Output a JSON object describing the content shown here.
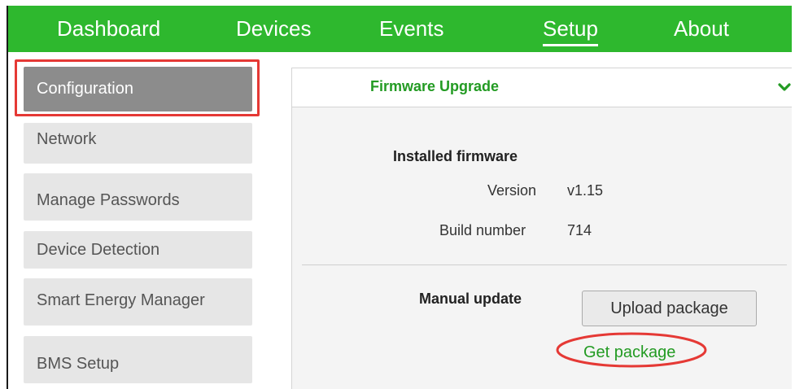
{
  "nav": {
    "items": [
      {
        "label": "Dashboard",
        "active": false
      },
      {
        "label": "Devices",
        "active": false
      },
      {
        "label": "Events",
        "active": false
      },
      {
        "label": "Setup",
        "active": true
      },
      {
        "label": "About",
        "active": false
      }
    ]
  },
  "sidebar": {
    "items": [
      {
        "label": "Configuration",
        "active": true
      },
      {
        "label": "Network",
        "active": false
      },
      {
        "label": "Manage Passwords",
        "active": false
      },
      {
        "label": "Device Detection",
        "active": false
      },
      {
        "label": "Smart Energy Manager",
        "active": false
      },
      {
        "label": "BMS Setup",
        "active": false
      }
    ]
  },
  "panel": {
    "title": "Firmware Upgrade",
    "expand_icon": "chevron-down-icon",
    "installed_heading": "Installed firmware",
    "version_label": "Version",
    "version_value": "v1.15",
    "build_label": "Build number",
    "build_value": "714",
    "manual_label": "Manual update",
    "upload_button": "Upload package",
    "get_link": "Get package"
  },
  "colors": {
    "nav_bg": "#2eb82e",
    "accent_green": "#239b23",
    "sidebar_active": "#8c8c8c",
    "sidebar_bg": "#e6e6e6",
    "annotation_red": "#e53935"
  }
}
